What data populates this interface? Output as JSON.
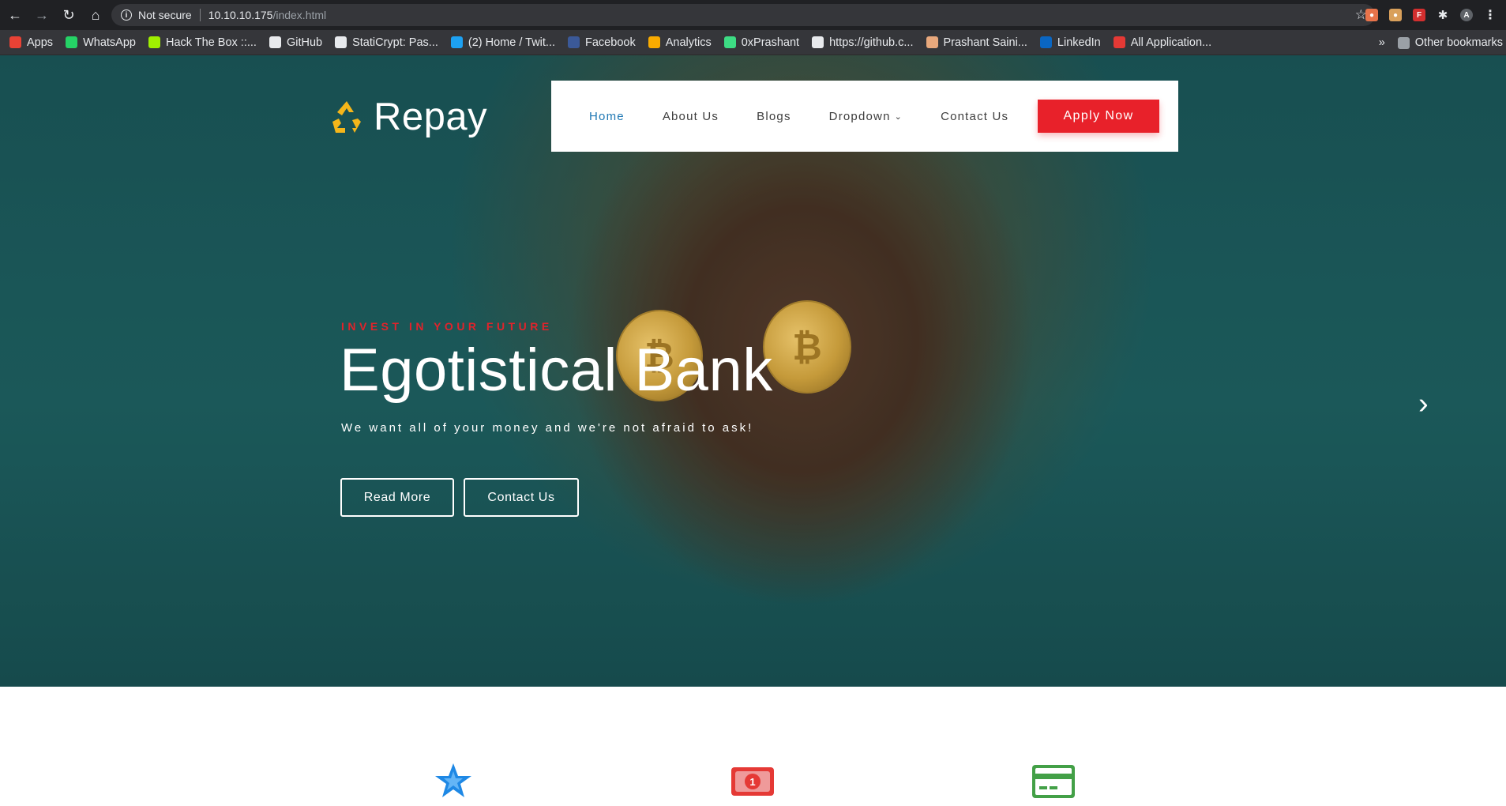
{
  "browser": {
    "security_label": "Not secure",
    "url_host": "10.10.10.175",
    "url_path": "/index.html"
  },
  "bookmarks": [
    {
      "label": "Apps",
      "icon": "apps-grid-icon",
      "color": "#e94235"
    },
    {
      "label": "WhatsApp",
      "icon": "whatsapp-icon",
      "color": "#25d366"
    },
    {
      "label": "Hack The Box ::...",
      "icon": "hackthebox-icon",
      "color": "#9fef00"
    },
    {
      "label": "GitHub",
      "icon": "github-icon",
      "color": "#e8eaed"
    },
    {
      "label": "StatiCrypt: Pas...",
      "icon": "globe-icon",
      "color": "#e8eaed"
    },
    {
      "label": "(2) Home / Twit...",
      "icon": "twitter-icon",
      "color": "#1da1f2"
    },
    {
      "label": "Facebook",
      "icon": "facebook-icon",
      "color": "#3b5998"
    },
    {
      "label": "Analytics",
      "icon": "analytics-icon",
      "color": "#f9ab00"
    },
    {
      "label": "0xPrashant",
      "icon": "prashant-icon",
      "color": "#3ddc84"
    },
    {
      "label": "https://github.c...",
      "icon": "github-icon",
      "color": "#e8eaed"
    },
    {
      "label": "Prashant Saini...",
      "icon": "pin-icon",
      "color": "#e8a87c"
    },
    {
      "label": "LinkedIn",
      "icon": "linkedin-icon",
      "color": "#0a66c2"
    },
    {
      "label": "All Application...",
      "icon": "app-icon",
      "color": "#e53935"
    }
  ],
  "bookmarks_overflow": "»",
  "other_bookmarks": "Other bookmarks",
  "site": {
    "brand": "Repay",
    "nav": [
      {
        "label": "Home",
        "active": true
      },
      {
        "label": "About Us"
      },
      {
        "label": "Blogs"
      },
      {
        "label": "Dropdown",
        "has_caret": true
      },
      {
        "label": "Contact Us"
      }
    ],
    "apply_label": "Apply Now",
    "hero": {
      "eyebrow": "INVEST IN YOUR FUTURE",
      "headline": "Egotistical Bank",
      "tagline": "We want all of your money and we're not afraid to ask!",
      "read_more": "Read More",
      "contact_us": "Contact Us"
    }
  },
  "colors": {
    "accent_red": "#e8212a",
    "nav_active": "#1f78b4",
    "hero_teal": "#1f6566",
    "feature_blue": "#1e88e5",
    "feature_red": "#e53935",
    "feature_green": "#43a047"
  },
  "features": [
    {
      "icon": "star-icon"
    },
    {
      "icon": "money-bill-icon"
    },
    {
      "icon": "credit-card-icon"
    }
  ]
}
